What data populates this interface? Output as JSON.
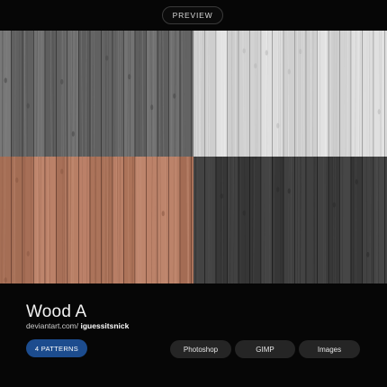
{
  "header": {
    "preview_label": "PREVIEW"
  },
  "swatches": [
    {
      "name": "gray",
      "base": "#6a6a6a",
      "grain_dark": "#4a4a4a",
      "grain_light": "#8a8a8a",
      "seam": "#3a3a3a"
    },
    {
      "name": "white",
      "base": "#d9d9d9",
      "grain_dark": "#b9b9b9",
      "grain_light": "#f0f0f0",
      "seam": "#9a9a9a"
    },
    {
      "name": "brown",
      "base": "#b47a60",
      "grain_dark": "#8c5a44",
      "grain_light": "#cf9880",
      "seam": "#6e4434"
    },
    {
      "name": "dark",
      "base": "#3d3d3d",
      "grain_dark": "#2b2b2b",
      "grain_light": "#515151",
      "seam": "#1e1e1e"
    }
  ],
  "info": {
    "title": "Wood A",
    "site": "deviantart.com/",
    "author": "iguessitsnick",
    "patterns_label": "4 PATTERNS"
  },
  "formats": [
    "Photoshop",
    "GIMP",
    "Images"
  ],
  "colors": {
    "accent": "#1c4c8e",
    "background": "#060606",
    "chip": "#252525"
  }
}
